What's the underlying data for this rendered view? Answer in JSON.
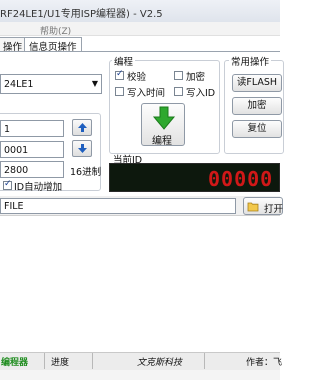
{
  "window": {
    "title": "RF24LE1/U1专用ISP编程器) - V2.5"
  },
  "menu": {
    "help_label": "帮助(Z)"
  },
  "tabs": [
    {
      "label": "操作"
    },
    {
      "label": "信息页操作"
    }
  ],
  "chip": {
    "selected": "24LE1"
  },
  "addr": {
    "field1_value": "1",
    "field2_value": "0001",
    "field3_value": "2800",
    "hex_label": "16进制",
    "auto_inc_label": "ID自动增加",
    "auto_inc_checked": true
  },
  "program_group": {
    "title": "编程",
    "options": [
      {
        "label": "校验",
        "checked": true
      },
      {
        "label": "加密",
        "checked": false
      },
      {
        "label": "写入时间",
        "checked": false
      },
      {
        "label": "写入ID",
        "checked": false
      }
    ],
    "program_button_label": "编程"
  },
  "common_group": {
    "title": "常用操作",
    "buttons": [
      {
        "label": "读FLASH"
      },
      {
        "label": "加密"
      },
      {
        "label": "复位"
      }
    ]
  },
  "current_id": {
    "label": "当前ID",
    "display": "00000"
  },
  "file": {
    "path": "FILE",
    "open_label": "打开"
  },
  "status": {
    "seg1": "编程器",
    "seg2": "进度",
    "seg3": "文克斯科技",
    "seg4": "作者：飞"
  },
  "colors": {
    "led_bg": "#0d180d",
    "led_digit": "#d01818",
    "accent_blue": "#1f5fbf",
    "program_arrow": "#2ea82e",
    "status_green": "#1e8c1e"
  }
}
